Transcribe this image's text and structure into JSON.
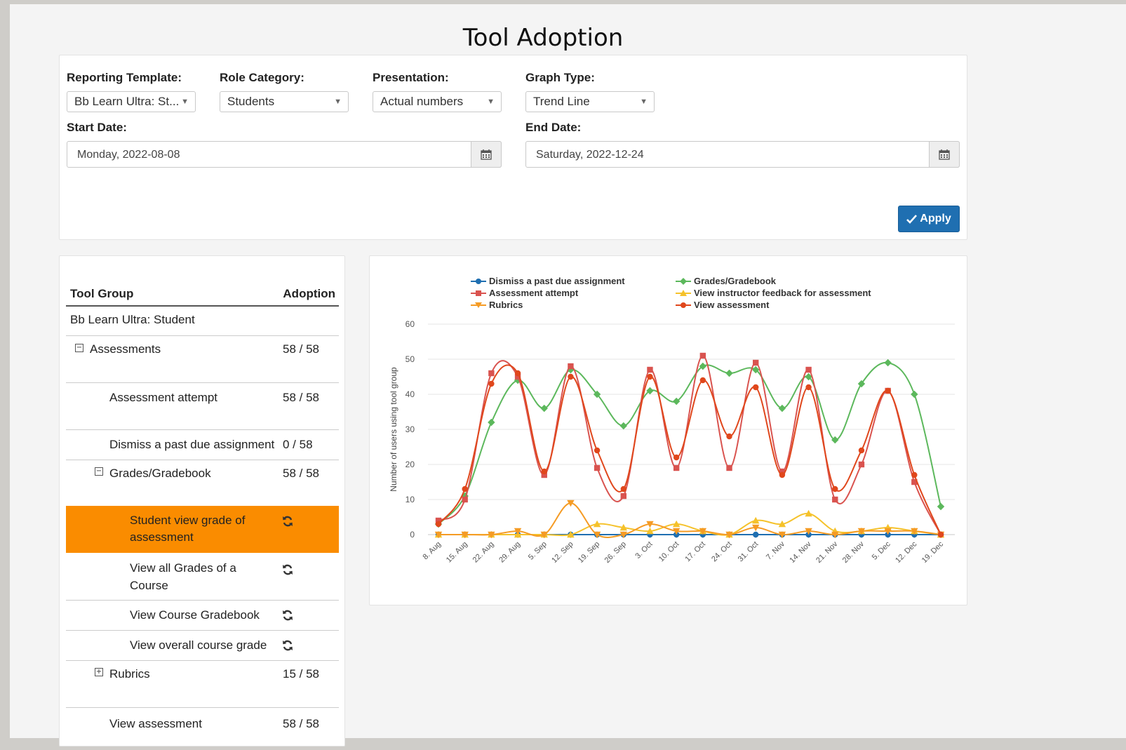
{
  "page": {
    "title": "Tool Adoption"
  },
  "filters": {
    "reporting_template": {
      "label": "Reporting Template:",
      "value": "Bb Learn Ultra: St..."
    },
    "role_category": {
      "label": "Role Category:",
      "value": "Students"
    },
    "presentation": {
      "label": "Presentation:",
      "value": "Actual numbers"
    },
    "graph_type": {
      "label": "Graph Type:",
      "value": "Trend Line"
    },
    "start_date": {
      "label": "Start Date:",
      "value": "Monday, 2022-08-08"
    },
    "end_date": {
      "label": "End Date:",
      "value": "Saturday, 2022-12-24"
    },
    "apply_label": "Apply"
  },
  "table": {
    "headers": {
      "group": "Tool Group",
      "adoption": "Adoption"
    },
    "rows": [
      {
        "label": "Bb Learn Ultra: Student",
        "value": ""
      },
      {
        "label": "Assessments",
        "value": "58 / 58"
      },
      {
        "label": "Assessment attempt",
        "value": "58 / 58"
      },
      {
        "label": "Dismiss a past due assignment",
        "value": "0 / 58"
      },
      {
        "label": "Grades/Gradebook",
        "value": "58 / 58"
      },
      {
        "label_line1": "Student view grade of",
        "label_line2": "assessment",
        "value": ""
      },
      {
        "label_line1": "View all Grades of a",
        "label_line2": "Course",
        "value": ""
      },
      {
        "label": "View Course Gradebook",
        "value": ""
      },
      {
        "label": "View overall course grade",
        "value": ""
      },
      {
        "label": "Rubrics",
        "value": "15 / 58"
      },
      {
        "label": "View assessment",
        "value": "58 / 58"
      }
    ]
  },
  "colors": {
    "dismiss": "#1f6fb1",
    "attempt": "#d9534f",
    "rubrics": "#f59b24",
    "grades": "#5cb85c",
    "feedback": "#f5c22b",
    "view": "#e0471c",
    "selected_row": "#fa8c00",
    "apply_button": "#1f6fb1"
  },
  "chart_data": {
    "type": "line",
    "ylabel": "Number of users using tool group",
    "xlabel": "",
    "ylim": [
      0,
      60
    ],
    "yticks": [
      0,
      10,
      20,
      30,
      40,
      50,
      60
    ],
    "legend": "top",
    "grid": true,
    "categories": [
      "8. Aug",
      "15. Aug",
      "22. Aug",
      "29. Aug",
      "5. Sep",
      "12. Sep",
      "19. Sep",
      "26. Sep",
      "3. Oct",
      "10. Oct",
      "17. Oct",
      "24. Oct",
      "31. Oct",
      "7. Nov",
      "14. Nov",
      "21. Nov",
      "28. Nov",
      "5. Dec",
      "12. Dec",
      "19. Dec"
    ],
    "series": [
      {
        "name": "Dismiss a past due assignment",
        "marker": "circle",
        "color_key": "dismiss",
        "values": [
          0,
          0,
          0,
          0,
          0,
          0,
          0,
          0,
          0,
          0,
          0,
          0,
          0,
          0,
          0,
          0,
          0,
          0,
          0,
          0
        ]
      },
      {
        "name": "Grades/Gradebook",
        "marker": "diamond",
        "color_key": "grades",
        "values": [
          3,
          11,
          32,
          44,
          36,
          47,
          40,
          31,
          41,
          38,
          48,
          46,
          47,
          36,
          45,
          27,
          43,
          49,
          40,
          8
        ]
      },
      {
        "name": "Assessment attempt",
        "marker": "square",
        "color_key": "attempt",
        "values": [
          4,
          10,
          46,
          45,
          17,
          48,
          19,
          11,
          47,
          19,
          51,
          19,
          49,
          18,
          47,
          10,
          20,
          41,
          15,
          0
        ]
      },
      {
        "name": "View instructor feedback for assessment",
        "marker": "triangle",
        "color_key": "feedback",
        "values": [
          0,
          0,
          0,
          0,
          0,
          0,
          3,
          2,
          1,
          3,
          1,
          0,
          4,
          3,
          6,
          1,
          1,
          2,
          1,
          0
        ]
      },
      {
        "name": "Rubrics",
        "marker": "triangle-down",
        "color_key": "rubrics",
        "values": [
          0,
          0,
          0,
          1,
          0,
          9,
          0,
          0,
          3,
          1,
          1,
          0,
          2,
          0,
          1,
          0,
          1,
          1,
          1,
          0
        ]
      },
      {
        "name": "View assessment",
        "marker": "circle",
        "color_key": "view",
        "values": [
          3,
          13,
          43,
          46,
          18,
          45,
          24,
          13,
          45,
          22,
          44,
          28,
          42,
          17,
          42,
          13,
          24,
          41,
          17,
          0
        ]
      }
    ]
  }
}
